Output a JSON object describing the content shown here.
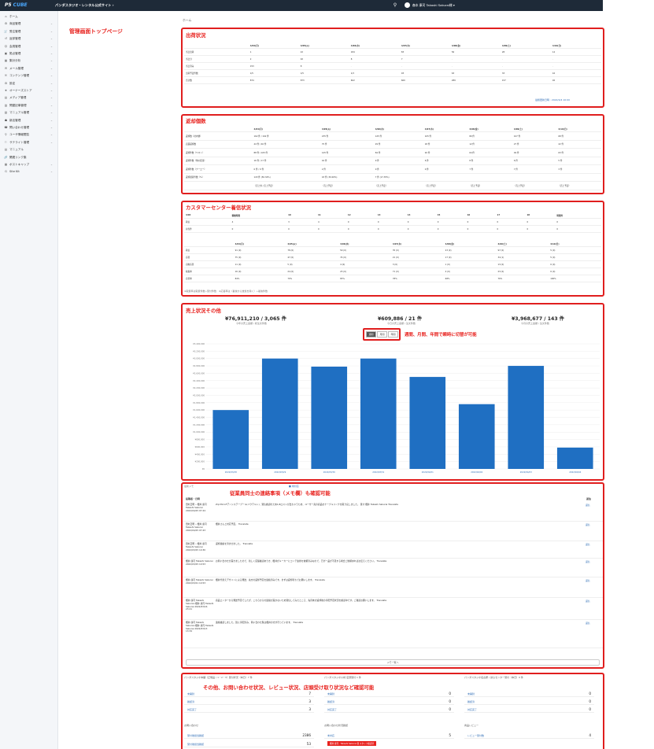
{
  "topbar": {
    "logo_main": "P5 ",
    "logo_accent": "CUBE",
    "site": "パンダスタジオ・レンタル公式サイト ›",
    "user": "森本 康司 Takashi Sakurai様 ▾"
  },
  "sidebar": {
    "items": [
      {
        "icon": "⌂",
        "label": "ホーム",
        "chev": ""
      },
      {
        "icon": "⚙",
        "label": "商品管理",
        "chev": "⌄"
      },
      {
        "icon": "🛒",
        "label": "受注管理",
        "chev": "⌄"
      },
      {
        "icon": "↺",
        "label": "返却管理",
        "chev": "⌄"
      },
      {
        "icon": "☺",
        "label": "会員管理",
        "chev": "⌄"
      },
      {
        "icon": "▣",
        "label": "拠点管理",
        "chev": "⌄"
      },
      {
        "icon": "▦",
        "label": "集計分析",
        "chev": "⌄"
      },
      {
        "icon": "✉",
        "label": "メール管理",
        "chev": "⌄"
      },
      {
        "icon": "🗎",
        "label": "コンテンツ管理",
        "chev": "⌄"
      },
      {
        "icon": "⚙",
        "label": "設定",
        "chev": "⌄"
      },
      {
        "icon": "★",
        "label": "オーナーズストア",
        "chev": "⌄"
      },
      {
        "icon": "▤",
        "label": "メディア管理",
        "chev": "⌄"
      },
      {
        "icon": "▥",
        "label": "問屋記事管理",
        "chev": "⌄"
      },
      {
        "icon": "▧",
        "label": "マニュアル管理",
        "chev": "⌄"
      },
      {
        "icon": "☗",
        "label": "新店管理",
        "chev": "⌄"
      },
      {
        "icon": "☎",
        "label": "問い合わせ管理",
        "chev": "⌄"
      },
      {
        "icon": "⚲",
        "label": "ユーザ情報閲覧",
        "chev": "⌄"
      },
      {
        "icon": "⚐",
        "label": "サテライト管理",
        "chev": "⌄"
      },
      {
        "icon": "▤",
        "label": "マニュアル",
        "chev": ""
      },
      {
        "icon": "🔗",
        "label": "関連リンク集",
        "chev": ""
      },
      {
        "icon": "▦",
        "label": "ポストキャップ",
        "chev": "⌄"
      },
      {
        "icon": "G",
        "label": "Site Kit",
        "chev": "⌄"
      }
    ]
  },
  "annotations": {
    "top": "管理画面トップページ",
    "toggle": "週間、月間、年間で瞬時に切替が可能",
    "memo": "従業員同士の連絡事項（メモ欄）も確認可能",
    "bottom": "その他、お問い合わせ状況、レビュー状況、店頭受け取り状況など確認可能"
  },
  "breadcrumb": "ホーム",
  "shipping": {
    "title": "出荷状況",
    "headers": [
      "",
      "4/04(月)",
      "4/05(火)",
      "4/06(水)",
      "4/07(木)",
      "4/08(金)",
      "4/09(土)",
      "4/10(日)"
    ],
    "rows": [
      [
        "当日出荷",
        "1",
        "22",
        "184",
        "83",
        "56",
        "28",
        "14"
      ],
      [
        "当日分",
        "2",
        "92",
        "8",
        "7",
        "-",
        "-",
        "-"
      ],
      [
        "当日済み",
        "153",
        "8",
        "-",
        "-",
        "-",
        "-",
        "-"
      ],
      [
        "出荷予定件数",
        "1/5",
        "1/5",
        "1/3",
        "93",
        "63",
        "33",
        "16"
      ],
      [
        "合計数",
        "874",
        "873",
        "602",
        "600",
        "289",
        "157",
        "92"
      ]
    ],
    "footer": "最終更新日時 : 2022/4/4 10:00"
  },
  "returns": {
    "title": "返却個数",
    "headers": [
      "",
      "4/04(月)",
      "4/05(火)",
      "4/06(水)",
      "4/07(木)",
      "4/08(金)",
      "4/09(土)",
      "4/10(日)"
    ],
    "rows": [
      [
        "返却数（社内便）",
        "162 件 / 162 件",
        "235 件",
        "125 件",
        "105 件",
        "80 件",
        "107 件",
        "68 件"
      ],
      [
        "店舗返却数",
        "44 件 / 40 件",
        "75 件",
        "29 件",
        "18 件",
        "12 件",
        "27 件",
        "22 件"
      ],
      [
        "返却件数（ヤマト）",
        "88 件 / 105 件",
        "145 件",
        "84 件",
        "92 件",
        "64 件",
        "49 件",
        "63 件"
      ],
      [
        "返却件数（他の配達）",
        "16 件 / 17 件",
        "16 件",
        "9 件",
        "6 件",
        "8 件",
        "6 件",
        "5 件"
      ],
      [
        "返却件数（ナーエー）",
        "0 件 / 0 件",
        "2 件",
        "0 件",
        "0 件",
        "7 件",
        "7 件",
        "3 件"
      ],
      [
        "返却遅延件数（%）",
        "143 件 (50.34%)",
        "43 件 (30.00%)",
        "7 件 (17.35%)",
        "",
        "",
        "",
        ""
      ],
      [
        "",
        "（売上外 / 売上予定）",
        "（売上予定）",
        "（売上予定）",
        "（売上予定）",
        "（売上予定）",
        "（売上予定）",
        "（売上予定）"
      ]
    ]
  },
  "call": {
    "title": "カスタマーセンター着信状況",
    "headers1": [
      "4/04",
      "稼動時間",
      "10",
      "11",
      "12",
      "13",
      "14",
      "15",
      "16",
      "17",
      "18",
      "時間外"
    ],
    "rows1": [
      [
        "着信",
        "4",
        "3",
        "4",
        "0",
        "0",
        "0",
        "0",
        "0",
        "0",
        "0",
        "0"
      ],
      [
        "担当件",
        "0",
        "0",
        "0",
        "0",
        "0",
        "0",
        "0",
        "0",
        "0",
        "0",
        "0"
      ]
    ],
    "headers2": [
      "",
      "4/04(月)",
      "4/05(火)",
      "4/06(水)",
      "4/07(木)",
      "4/08(金)",
      "4/09(土)",
      "4/10(日)"
    ],
    "rows2": [
      [
        "着信",
        "91 (0)",
        "78 (0)",
        "50 (0)",
        "35 (0)",
        "23 (0)",
        "97 (0)",
        "5 (0)"
      ],
      [
        "応答",
        "75 (0)",
        "47 (0)",
        "74 (0)",
        "21 (0)",
        "17 (0)",
        "34 (1)",
        "5 (0)"
      ],
      [
        "自動応答",
        "11 (0)",
        "5 (0)",
        "4 (0)",
        "3 (0)",
        "1 (0)",
        "13 (0)",
        "0 (0)"
      ],
      [
        "取扱率",
        "16 (0)",
        "24 (0)",
        "23 (0)",
        "71 (0)",
        "4 (0)",
        "23 (0)",
        "0 (0)"
      ],
      [
        "応答率",
        "84%",
        "70%",
        "83%",
        "78%",
        "68%",
        "76%",
        "100%"
      ]
    ],
    "footnote": "※取扱率は取扱件数÷受付件数　※応答率は（着信から放棄を除く）÷着信件数"
  },
  "sales": {
    "title": "売上状況その他",
    "stats": [
      {
        "value": "¥76,911,210 / 3,065 件",
        "sub": "今年の売上金額 / 総注文件数"
      },
      {
        "value": "¥609,886 / 21 件",
        "sub": "今日の売上金額 / 注文件数"
      },
      {
        "value": "¥3,968,677 / 143 件",
        "sub": "今月の売上金額 / 注文件数"
      }
    ],
    "toggle": [
      "週間",
      "月間",
      "年間"
    ]
  },
  "chart_data": {
    "type": "bar",
    "categories": [
      "2022/03/28",
      "2022/03/29",
      "2022/03/30",
      "2022/03/31",
      "2022/04/01",
      "2022/04/02",
      "2022/04/03",
      "2022/04/04"
    ],
    "values": [
      1600000,
      3000000,
      2780000,
      3000000,
      2500000,
      1760000,
      2800000,
      580000
    ],
    "yticks": [
      "¥3,400,000",
      "¥3,200,000",
      "¥3,000,000",
      "¥2,800,000",
      "¥2,600,000",
      "¥2,400,000",
      "¥2,200,000",
      "¥2,000,000",
      "¥1,800,000",
      "¥1,600,000",
      "¥1,400,000",
      "¥1,200,000",
      "¥1,000,000",
      "¥800,000",
      "¥600,000",
      "¥400,000",
      "¥200,000",
      "¥0"
    ],
    "ylim": [
      0,
      3400000
    ],
    "color": "#1f6fc2",
    "grid": true
  },
  "memo": {
    "title": "最新メモ",
    "legend": "■ 未対応",
    "headers": [
      "投稿者・日時",
      "",
      "返信"
    ],
    "rows": [
      {
        "a": "田村正明 • 櫻井 康司 Takashi Sakurai 2022/04/25 07:24",
        "b": "Zip MicroFアンシステーブール(ハウテルト)、受信確認のため1/4ロストが出ちゃうため、ユーザー宛の商品をケーブルリンクを取り戻しました。 受け 櫻井 Takashi Sakurai Translate",
        "c": "返信"
      },
      {
        "a": "田村正明 • 櫻井 康司 Takashi Sakurai 2022/04/25 07:43",
        "b": "櫻井さんと対応予定。 Translate",
        "c": "返信"
      },
      {
        "a": "田村正明 • 櫻井 康司 Takashi Sakurai 2022/03/25 10:30",
        "b": "返却連絡を済ませました。 Translate",
        "c": "返信"
      },
      {
        "a": "櫻井 康司 Takashi Sakurai 2022/03/25 10:53",
        "b": "お問い合わせが届きましたので、新しく店舗確認ありき、櫻井がメーカーにコンテ進捗を依頼済みなので、万が一品が不足する場合ご依頼あればお伝えください。 Translate",
        "c": "返信"
      },
      {
        "a": "櫻井 康司 Takashi Sakurai 2022/03/21 10:53",
        "b": "櫻井代替えデザインによる発送、先方の返却予定を連絡済みです。まずは返却待ちでお願いします。 Translate",
        "c": "返信"
      },
      {
        "a": "櫻井 康司 Takashi Sakurai•櫻井 康司 Takashi Sakurai 2022/03/16 23:21",
        "b": "商品エンターから発送予定でしたが、こちらからの連絡が届かないため受信してみたところ、先月末の返却後の手配予定状況を確認中です。ご確認お願いします。 Translate",
        "c": "返信"
      },
      {
        "a": "櫻井 康司 Takashi Sakurai•櫻井 康司 Takashi Sakurai 2022/03/13 13:34",
        "b": "連絡確認しました。既に手配済み、問い合わせ覧は櫻井の方が行っています。 Translate",
        "c": "返信"
      }
    ],
    "more": "メモ一覧へ"
  },
  "bottom": {
    "cards": [
      {
        "title": "パンダスタジオ本舗（正規品 / 1・2・3）受付状況（本日）7 件",
        "rows": [
          [
            "未開封",
            "7"
          ],
          [
            "確認済",
            "3"
          ],
          [
            "対応完了",
            "3"
          ]
        ]
      },
      {
        "title": "パンダスタジオ川崎 店頭受付 1 件",
        "rows": [
          [
            "未開封",
            "0"
          ],
          [
            "確認済",
            "0"
          ],
          [
            "対応完了",
            "0"
          ]
        ]
      },
      {
        "title": "パンダスタジオ名古屋 / 熱心センター受付（本日）0 件",
        "rows": [
          [
            "未開封",
            "0"
          ],
          [
            "確認済",
            "0"
          ],
          [
            "対応完了",
            "0"
          ]
        ]
      }
    ],
    "cards2": [
      {
        "title": "お問い合わせ",
        "rows": [
          [
            "受付後担当確認",
            "2386"
          ],
          [
            "受付後担当確認",
            "53"
          ]
        ]
      },
      {
        "title": "お問い合わせ状況確認",
        "rows": [
          [
            "未対応",
            "5"
          ]
        ],
        "badge": "櫻井 康司 · Takashi Sakurai 様 スタッフ確認済"
      },
      {
        "title": "商品レビュー",
        "rows": [
          [
            "レビュー受付数",
            "4"
          ]
        ]
      }
    ]
  }
}
